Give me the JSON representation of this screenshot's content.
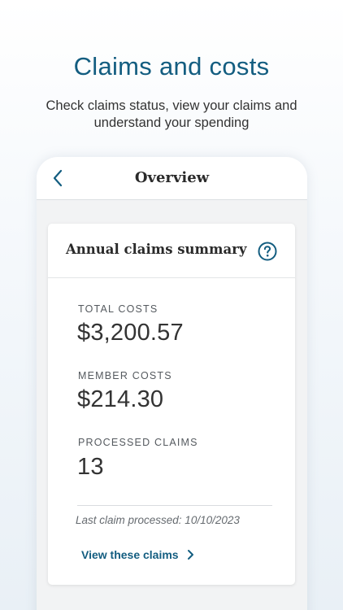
{
  "promo": {
    "title": "Claims and costs",
    "subtitle": "Check claims status, view your claims and understand your spending"
  },
  "header": {
    "title": "Overview",
    "back_icon": "chevron-left-icon"
  },
  "summary_card": {
    "title": "Annual claims summary",
    "help_icon": "question-circle-icon",
    "metrics": [
      {
        "label": "TOTAL COSTS",
        "value": "$3,200.57"
      },
      {
        "label": "MEMBER COSTS",
        "value": "$214.30"
      },
      {
        "label": "PROCESSED CLAIMS",
        "value": "13"
      }
    ],
    "last_claim_text": "Last claim processed: 10/10/2023",
    "link_label": "View these claims",
    "link_icon": "chevron-right-icon"
  },
  "colors": {
    "brand": "#135d80",
    "text": "#333333",
    "card_bg": "#ffffff",
    "screen_bg": "#f2f3f4"
  }
}
